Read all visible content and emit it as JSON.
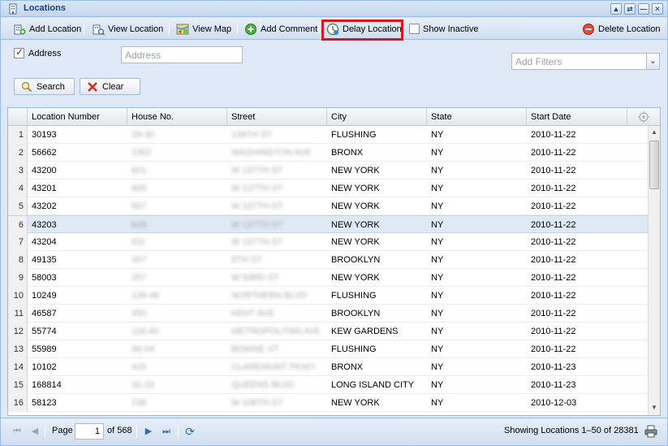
{
  "window": {
    "title": "Locations",
    "tools": [
      "▲",
      "⇄",
      "—",
      "✕"
    ]
  },
  "toolbar": {
    "add_location": "Add Location",
    "view_location": "View Location",
    "view_map": "View Map",
    "add_comment": "Add Comment",
    "delay_location": "Delay Location",
    "show_inactive": "Show Inactive",
    "delete_location": "Delete Location"
  },
  "filters": {
    "address_checkbox_label": "Address",
    "address_checked": true,
    "address_placeholder": "Address",
    "filters_placeholder": "Add Filters",
    "search_label": "Search",
    "clear_label": "Clear"
  },
  "grid": {
    "columns": [
      "Location Number",
      "House No.",
      "Street",
      "City",
      "State",
      "Start Date"
    ],
    "rows": [
      {
        "n": "1",
        "loc": "30193",
        "house": "29-30",
        "street": "138TH ST",
        "city": "FLUSHING",
        "state": "NY",
        "date": "2010-11-22"
      },
      {
        "n": "2",
        "loc": "56662",
        "house": "2302",
        "street": "WASHINGTON AVE",
        "city": "BRONX",
        "state": "NY",
        "date": "2010-11-22"
      },
      {
        "n": "3",
        "loc": "43200",
        "house": "601",
        "street": "W 137TH ST",
        "city": "NEW YORK",
        "state": "NY",
        "date": "2010-11-22"
      },
      {
        "n": "4",
        "loc": "43201",
        "house": "605",
        "street": "W 137TH ST",
        "city": "NEW YORK",
        "state": "NY",
        "date": "2010-11-22"
      },
      {
        "n": "5",
        "loc": "43202",
        "house": "607",
        "street": "W 137TH ST",
        "city": "NEW YORK",
        "state": "NY",
        "date": "2010-11-22"
      },
      {
        "n": "6",
        "loc": "43203",
        "house": "609",
        "street": "W 137TH ST",
        "city": "NEW YORK",
        "state": "NY",
        "date": "2010-11-22"
      },
      {
        "n": "7",
        "loc": "43204",
        "house": "611",
        "street": "W 137TH ST",
        "city": "NEW YORK",
        "state": "NY",
        "date": "2010-11-22"
      },
      {
        "n": "8",
        "loc": "49135",
        "house": "357",
        "street": "9TH ST",
        "city": "BROOKLYN",
        "state": "NY",
        "date": "2010-11-22"
      },
      {
        "n": "9",
        "loc": "58003",
        "house": "257",
        "street": "W 93RD ST",
        "city": "NEW YORK",
        "state": "NY",
        "date": "2010-11-22"
      },
      {
        "n": "10",
        "loc": "10249",
        "house": "136-46",
        "street": "NORTHERN BLVD",
        "city": "FLUSHING",
        "state": "NY",
        "date": "2010-11-22"
      },
      {
        "n": "11",
        "loc": "46587",
        "house": "450",
        "street": "KENT AVE",
        "city": "BROOKLYN",
        "state": "NY",
        "date": "2010-11-22"
      },
      {
        "n": "12",
        "loc": "55774",
        "house": "118-40",
        "street": "METROPOLITAN AVE",
        "city": "KEW GARDENS",
        "state": "NY",
        "date": "2010-11-22"
      },
      {
        "n": "13",
        "loc": "55989",
        "house": "46-04",
        "street": "BOWNE ST",
        "city": "FLUSHING",
        "state": "NY",
        "date": "2010-11-22"
      },
      {
        "n": "14",
        "loc": "10102",
        "house": "415",
        "street": "CLAREMONT PKWY",
        "city": "BRONX",
        "state": "NY",
        "date": "2010-11-23"
      },
      {
        "n": "15",
        "loc": "168814",
        "house": "32-23",
        "street": "QUEENS BLVD",
        "city": "LONG ISLAND CITY",
        "state": "NY",
        "date": "2010-11-23"
      },
      {
        "n": "16",
        "loc": "58123",
        "house": "238",
        "street": "W 106TH ST",
        "city": "NEW YORK",
        "state": "NY",
        "date": "2010-12-03"
      }
    ],
    "selected_row": 6
  },
  "pager": {
    "page_label": "Page",
    "page_value": "1",
    "of_label": "of 568",
    "status": "Showing Locations 1–50 of 28381"
  },
  "colors": {
    "header_text": "#15428b",
    "highlight_border": "#e0121b",
    "selected_row": "#dfe8f6",
    "panel_bg": "#dfe8f6"
  }
}
